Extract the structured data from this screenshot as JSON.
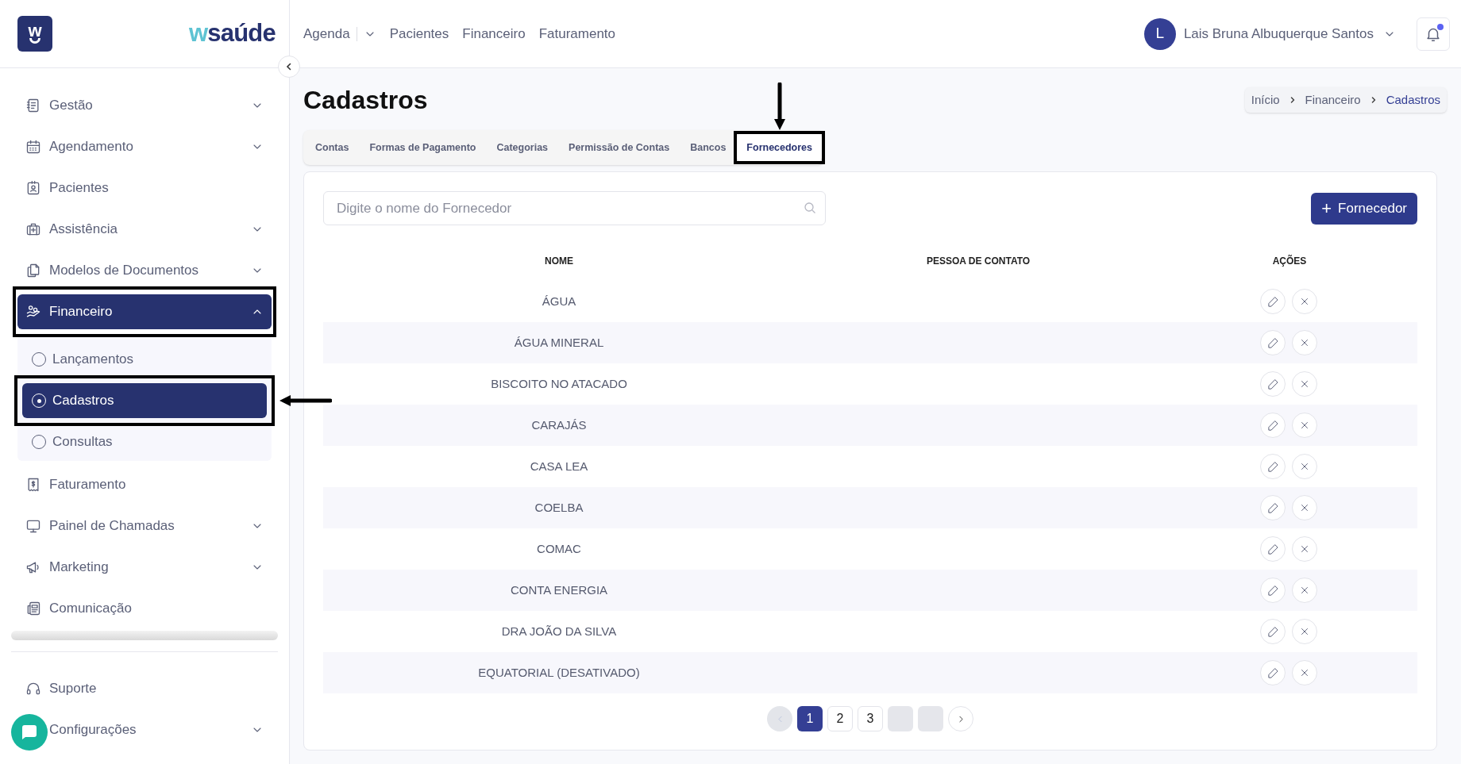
{
  "brand": {
    "app_icon_letter": "w",
    "logo_accent": "w",
    "logo_text": "saúde"
  },
  "top_nav": {
    "items": [
      {
        "label": "Agenda",
        "dropdown": true
      },
      {
        "label": "Pacientes",
        "dropdown": false
      },
      {
        "label": "Financeiro",
        "dropdown": false
      },
      {
        "label": "Faturamento",
        "dropdown": false
      }
    ],
    "user": {
      "initial": "L",
      "name": "Lais Bruna Albuquerque Santos"
    },
    "notifications_unread": true
  },
  "sidebar": {
    "items": [
      {
        "label": "Gestão",
        "expandable": true,
        "expanded": false,
        "selected": false,
        "highlighted": false
      },
      {
        "label": "Agendamento",
        "expandable": true,
        "expanded": false,
        "selected": false,
        "highlighted": false
      },
      {
        "label": "Pacientes",
        "expandable": false,
        "selected": false,
        "highlighted": false
      },
      {
        "label": "Assistência",
        "expandable": true,
        "expanded": false,
        "selected": false,
        "highlighted": false
      },
      {
        "label": "Modelos de Documentos",
        "expandable": true,
        "expanded": false,
        "selected": false,
        "highlighted": false
      },
      {
        "label": "Financeiro",
        "expandable": true,
        "expanded": true,
        "selected": true,
        "highlighted": true,
        "children": [
          {
            "label": "Lançamentos",
            "selected": false,
            "highlighted": false,
            "pointer_arrow": false
          },
          {
            "label": "Cadastros",
            "selected": true,
            "highlighted": true,
            "pointer_arrow": true
          },
          {
            "label": "Consultas",
            "selected": false,
            "highlighted": false,
            "pointer_arrow": false
          }
        ]
      },
      {
        "label": "Faturamento",
        "expandable": false,
        "selected": false,
        "highlighted": false
      },
      {
        "label": "Painel de Chamadas",
        "expandable": true,
        "expanded": false,
        "selected": false,
        "highlighted": false
      },
      {
        "label": "Marketing",
        "expandable": true,
        "expanded": false,
        "selected": false,
        "highlighted": false
      },
      {
        "label": "Comunicação",
        "expandable": false,
        "selected": false,
        "highlighted": false
      }
    ],
    "footer_items": [
      {
        "label": "Suporte",
        "expandable": false,
        "selected": false,
        "highlighted": false
      },
      {
        "label": "Configurações",
        "expandable": true,
        "expanded": false,
        "selected": false,
        "highlighted": false
      }
    ]
  },
  "page": {
    "title": "Cadastros",
    "breadcrumb": [
      {
        "label": "Início",
        "selected": false
      },
      {
        "label": "Financeiro",
        "selected": false
      },
      {
        "label": "Cadastros",
        "selected": true
      }
    ]
  },
  "tabs": [
    {
      "label": "Contas",
      "selected": false,
      "highlighted": false,
      "pointer_arrow": false
    },
    {
      "label": "Formas de Pagamento",
      "selected": false,
      "highlighted": false,
      "pointer_arrow": false
    },
    {
      "label": "Categorias",
      "selected": false,
      "highlighted": false,
      "pointer_arrow": false
    },
    {
      "label": "Permissão de Contas",
      "selected": false,
      "highlighted": false,
      "pointer_arrow": false
    },
    {
      "label": "Bancos",
      "selected": false,
      "highlighted": false,
      "pointer_arrow": false
    },
    {
      "label": "Fornecedores",
      "selected": true,
      "highlighted": true,
      "pointer_arrow": true
    }
  ],
  "search": {
    "placeholder": "Digite o nome do Fornecedor"
  },
  "add_button": {
    "icon": "+",
    "label": "Fornecedor"
  },
  "table": {
    "columns": [
      "NOME",
      "PESSOA DE CONTATO",
      "AÇÕES"
    ],
    "rows": [
      {
        "name": "ÁGUA"
      },
      {
        "name": "ÁGUA MINERAL"
      },
      {
        "name": "BISCOITO NO ATACADO"
      },
      {
        "name": "CARAJÁS"
      },
      {
        "name": "CASA LEA"
      },
      {
        "name": "COELBA"
      },
      {
        "name": "COMAC"
      },
      {
        "name": "CONTA ENERGIA"
      },
      {
        "name": "DRA JOÃO DA SILVA"
      },
      {
        "name": "EQUATORIAL (DESATIVADO)"
      }
    ]
  },
  "pagination": [
    {
      "kind": "prev",
      "disabled": true
    },
    {
      "kind": "page",
      "label": "1",
      "selected": true
    },
    {
      "kind": "page",
      "label": "2",
      "selected": false
    },
    {
      "kind": "page",
      "label": "3",
      "selected": false
    },
    {
      "kind": "blank"
    },
    {
      "kind": "blank"
    },
    {
      "kind": "next",
      "disabled": false
    }
  ]
}
